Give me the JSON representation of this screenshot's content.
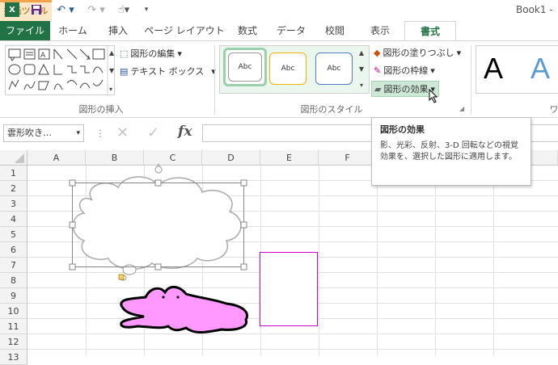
{
  "window": {
    "title": "Book1 -",
    "context_tab_group": "描画ツール"
  },
  "ribbon_tabs": [
    "ファイル",
    "ホーム",
    "挿入",
    "ページ レイアウト",
    "数式",
    "データ",
    "校閲",
    "表示",
    "書式"
  ],
  "ribbon": {
    "edit_shape": "図形の編集",
    "text_box": "テキスト ボックス",
    "group_insert_shapes": "図形の挿入",
    "style_samples": [
      "Abc",
      "Abc",
      "Abc"
    ],
    "group_shape_styles": "図形のスタイル",
    "shape_fill": "図形の塗りつぶし",
    "shape_outline": "図形の枠線",
    "shape_effects": "図形の効果",
    "wordart_sample": "A",
    "wordart_sample_2": "A",
    "group_wordart_partial": "ワ"
  },
  "formula_bar": {
    "name_box": "雲形吹き…",
    "fx": "fx"
  },
  "columns": [
    "A",
    "B",
    "C",
    "D",
    "E",
    "F"
  ],
  "rows": [
    "1",
    "2",
    "3",
    "4",
    "5",
    "6",
    "7",
    "8",
    "9",
    "10",
    "11",
    "12",
    "13"
  ],
  "tooltip": {
    "title": "図形の効果",
    "description": "影、光彩、反射、3-D 回転などの視覚効果を、選択した図形に適用します。"
  },
  "colors": {
    "excel_green": "#217346",
    "drawing_tools": "#fbe6c6",
    "shape_pink": "#ff99ff",
    "rect_outline": "#cc00cc"
  }
}
